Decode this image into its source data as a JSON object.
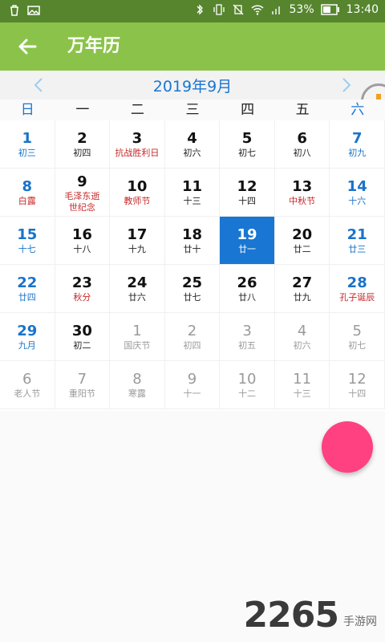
{
  "status_bar": {
    "battery": "53%",
    "time": "13:40",
    "icons": [
      "trash-icon",
      "image-icon",
      "bluetooth-icon",
      "vibrate-icon",
      "mute-icon",
      "wifi-icon",
      "signal-icon",
      "battery-icon"
    ]
  },
  "app_bar": {
    "title": "万年历",
    "back_icon": "arrow-left-icon"
  },
  "calendar": {
    "month_title": "2019年9月",
    "weekdays": [
      "日",
      "一",
      "二",
      "三",
      "四",
      "五",
      "六"
    ],
    "days": [
      {
        "n": "1",
        "l": "初三"
      },
      {
        "n": "2",
        "l": "初四"
      },
      {
        "n": "3",
        "l": "抗战胜利日"
      },
      {
        "n": "4",
        "l": "初六"
      },
      {
        "n": "5",
        "l": "初七"
      },
      {
        "n": "6",
        "l": "初八"
      },
      {
        "n": "7",
        "l": "初九"
      },
      {
        "n": "8",
        "l": "白露"
      },
      {
        "n": "9",
        "l": "毛泽东逝世纪念"
      },
      {
        "n": "10",
        "l": "教师节"
      },
      {
        "n": "11",
        "l": "十三"
      },
      {
        "n": "12",
        "l": "十四"
      },
      {
        "n": "13",
        "l": "中秋节"
      },
      {
        "n": "14",
        "l": "十六"
      },
      {
        "n": "15",
        "l": "十七"
      },
      {
        "n": "16",
        "l": "十八"
      },
      {
        "n": "17",
        "l": "十九"
      },
      {
        "n": "18",
        "l": "廿十"
      },
      {
        "n": "19",
        "l": "廿一"
      },
      {
        "n": "20",
        "l": "廿二"
      },
      {
        "n": "21",
        "l": "廿三"
      },
      {
        "n": "22",
        "l": "廿四"
      },
      {
        "n": "23",
        "l": "秋分"
      },
      {
        "n": "24",
        "l": "廿六"
      },
      {
        "n": "25",
        "l": "廿七"
      },
      {
        "n": "26",
        "l": "廿八"
      },
      {
        "n": "27",
        "l": "廿九"
      },
      {
        "n": "28",
        "l": "孔子诞辰"
      },
      {
        "n": "29",
        "l": "九月"
      },
      {
        "n": "30",
        "l": "初二"
      },
      {
        "n": "1",
        "l": "国庆节"
      },
      {
        "n": "2",
        "l": "初四"
      },
      {
        "n": "3",
        "l": "初五"
      },
      {
        "n": "4",
        "l": "初六"
      },
      {
        "n": "5",
        "l": "初七"
      },
      {
        "n": "6",
        "l": "老人节"
      },
      {
        "n": "7",
        "l": "重阳节"
      },
      {
        "n": "8",
        "l": "寒露"
      },
      {
        "n": "9",
        "l": "十一"
      },
      {
        "n": "10",
        "l": "十二"
      },
      {
        "n": "11",
        "l": "十三"
      },
      {
        "n": "12",
        "l": "十四"
      }
    ]
  },
  "watermark": {
    "number": "2265",
    "text": "手游网"
  },
  "colors": {
    "status_bar": "#56852e",
    "app_bar": "#8bc34a",
    "accent_blue": "#1976d2",
    "festival_red": "#c62828",
    "fab": "#ff4081"
  }
}
